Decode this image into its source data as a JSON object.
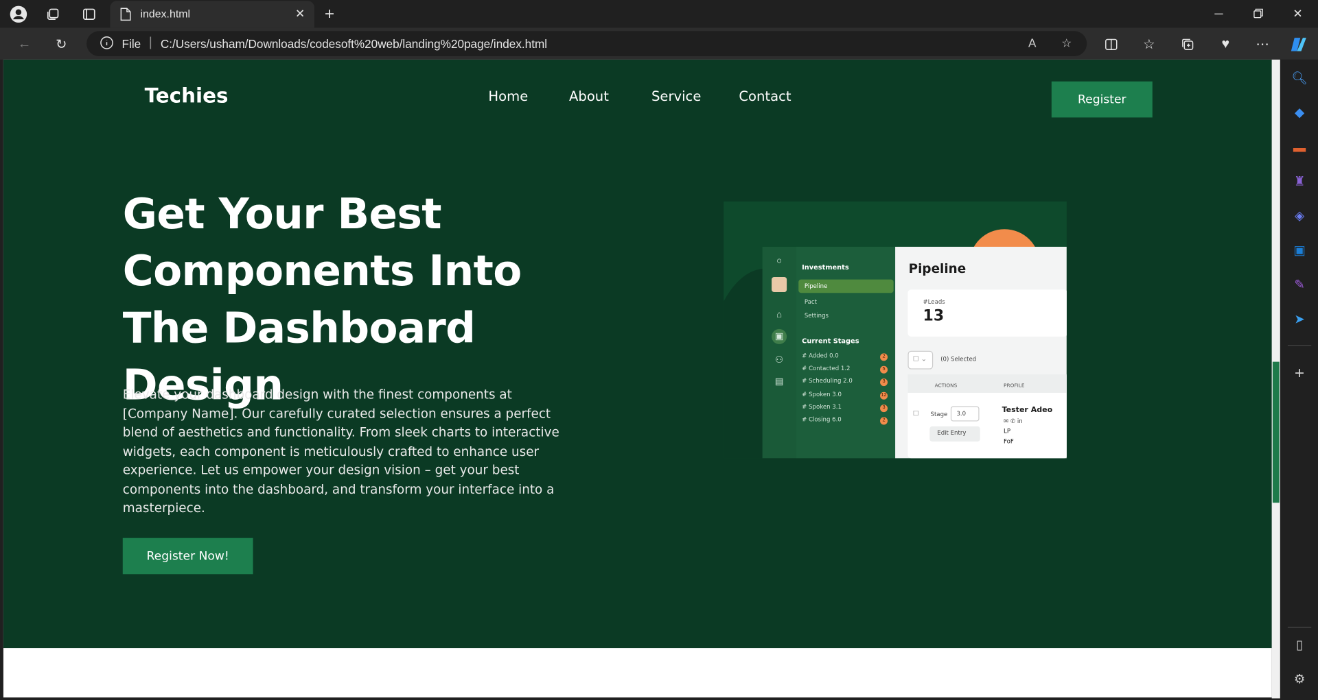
{
  "browser": {
    "tab_title": "index.html",
    "url_scheme_label": "File",
    "url": "C:/Users/usham/Downloads/codesoft%20web/landing%20page/index.html"
  },
  "nav": {
    "brand": "Techies",
    "links": [
      "Home",
      "About",
      "Service",
      "Contact"
    ],
    "register_label": "Register"
  },
  "hero": {
    "headline": "Get Your Best Components Into The Dashboard Design",
    "description": "Elevate your dashboard design with the finest components at [Company Name]. Our carefully curated selection ensures a perfect blend of aesthetics and functionality. From sleek charts to interactive widgets, each component is meticulously crafted to enhance user experience. Let us empower your design vision – get your best components into the dashboard, and transform your interface into a masterpiece.",
    "cta_label": "Register Now!"
  },
  "dashboard_image": {
    "menu_heading": "Investments",
    "menu_items": [
      "Pipeline",
      "Pact",
      "Settings"
    ],
    "stages_heading": "Current Stages",
    "stages": [
      {
        "label": "# Added  0.0",
        "count": "2"
      },
      {
        "label": "# Contacted  1.2",
        "count": "5"
      },
      {
        "label": "# Scheduling  2.0",
        "count": "3"
      },
      {
        "label": "# Spoken  3.0",
        "count": "12"
      },
      {
        "label": "# Spoken  3.1",
        "count": "3"
      },
      {
        "label": "# Closing  6.0",
        "count": "2"
      }
    ],
    "panel_title": "Pipeline",
    "leads_label": "#Leads",
    "leads_value": "13",
    "selected_label": "(0) Selected",
    "col_actions": "ACTIONS",
    "col_profile": "PROFILE",
    "stage_label": "Stage",
    "stage_value": "3.0",
    "edit_label": "Edit Entry",
    "profile_name": "Tester Adeo",
    "profile_line1": "LP",
    "profile_line2": "FoF"
  },
  "colors": {
    "hero_bg": "#0b3a24",
    "button_bg": "#1d7f4e",
    "accent_orange": "#f28c4b"
  }
}
